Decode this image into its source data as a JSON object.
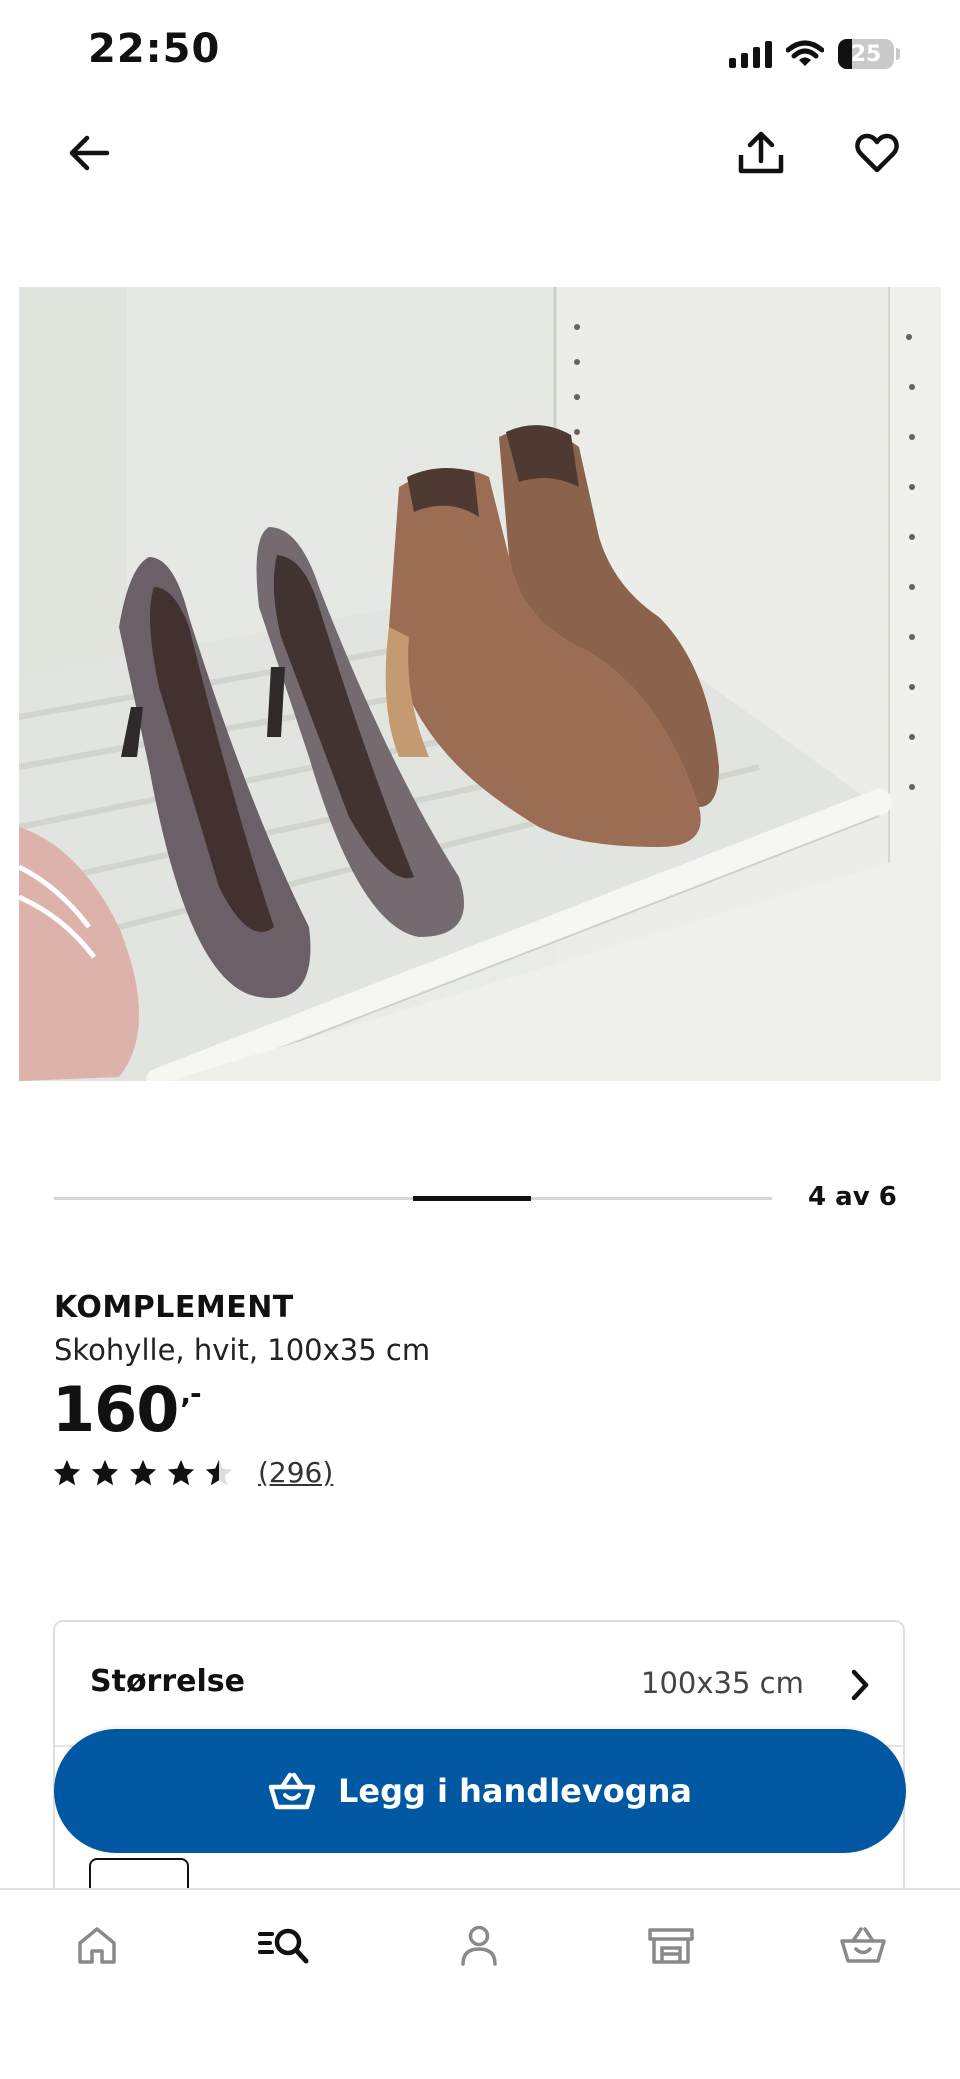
{
  "status_bar": {
    "time": "22:50",
    "battery_level": "25",
    "icons": [
      "signal-icon",
      "wifi-icon",
      "battery-icon"
    ]
  },
  "top_bar": {
    "icons": [
      "back-arrow-icon",
      "share-icon",
      "heart-icon"
    ]
  },
  "product_image": {
    "icon": "product-photo"
  },
  "carousel": {
    "counter": "4 av 6",
    "current": 4,
    "total": 6
  },
  "product": {
    "name": "KOMPLEMENT",
    "description": "Skohylle, hvit, 100x35 cm",
    "price": "160",
    "price_suffix": ",-",
    "rating": 4.5,
    "rating_count": "(296)"
  },
  "options": {
    "size_label": "Størrelse",
    "size_value": "100x35 cm"
  },
  "cart_button": {
    "label": "Legg i handlevogna",
    "color": "#0058a3"
  },
  "bottom_nav": {
    "items": [
      "home-icon",
      "search-icon",
      "profile-icon",
      "store-icon",
      "cart-icon"
    ]
  }
}
